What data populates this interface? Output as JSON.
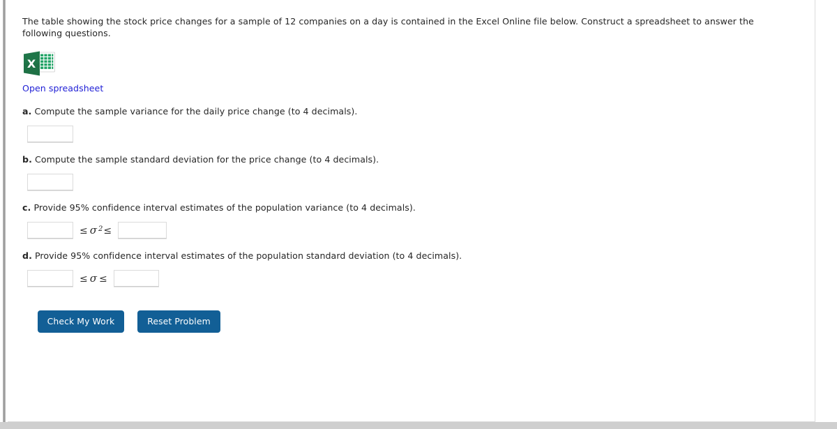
{
  "intro": {
    "text": "The table showing the stock price changes for a sample of 12 companies on a day is contained in the Excel Online file below. Construct a spreadsheet to answer the following questions."
  },
  "spreadsheet": {
    "icon_name": "excel-file-icon",
    "icon_letter": "X",
    "link_label": "Open spreadsheet",
    "link_color": "#2121d6",
    "icon_color": "#217346"
  },
  "questions": [
    {
      "label": "a.",
      "text": "Compute the sample variance for the daily price change (to 4 decimals).",
      "answer_value": "",
      "answer_placeholder": ""
    },
    {
      "label": "b.",
      "text": "Compute the sample standard deviation for the price change (to 4 decimals).",
      "answer_value": "",
      "answer_placeholder": ""
    },
    {
      "label": "c.",
      "text": "Provide 95% confidence interval estimates of the population variance (to 4 decimals).",
      "lower_value": "",
      "upper_value": "",
      "symbol": "σ",
      "exponent": "2",
      "relation": "≤"
    },
    {
      "label": "d.",
      "text": "Provide 95% confidence interval estimates of the population standard deviation (to 4 decimals).",
      "lower_value": "",
      "upper_value": "",
      "symbol": "σ",
      "exponent": "",
      "relation": "≤"
    }
  ],
  "buttons": {
    "check_label": "Check My Work",
    "reset_label": "Reset Problem",
    "color": "#125f96"
  }
}
